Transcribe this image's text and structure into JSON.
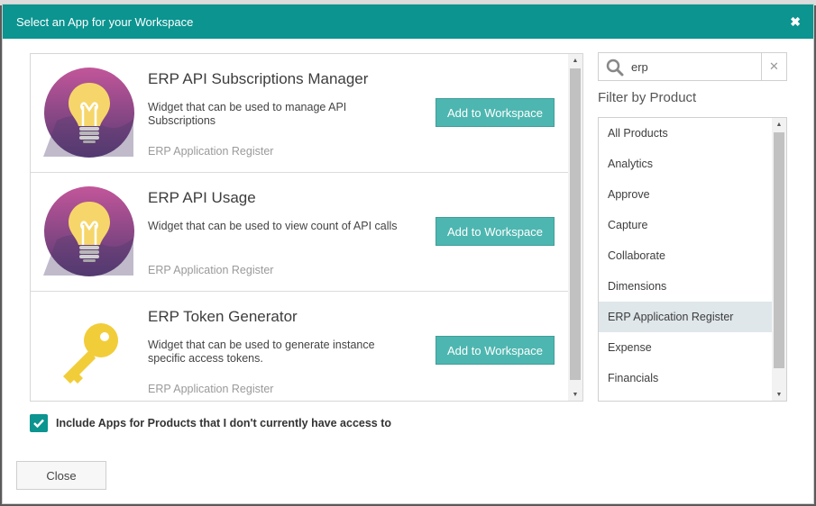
{
  "dialog": {
    "title": "Select an App for your Workspace",
    "close_symbol": "✖"
  },
  "apps": [
    {
      "title": "ERP API Subscriptions Manager",
      "description": "Widget that can be used to manage API Subscriptions",
      "product": "ERP Application Register",
      "button_label": "Add to Workspace",
      "icon": "lightbulb-icon"
    },
    {
      "title": "ERP API Usage",
      "description": "Widget that can be used to view count of API calls",
      "product": "ERP Application Register",
      "button_label": "Add to Workspace",
      "icon": "lightbulb-icon"
    },
    {
      "title": "ERP Token Generator",
      "description": "Widget that can be used to generate instance specific access tokens.",
      "product": "ERP Application Register",
      "button_label": "Add to Workspace",
      "icon": "key-icon"
    }
  ],
  "search": {
    "value": "erp",
    "clear_symbol": "✕"
  },
  "filter": {
    "label": "Filter by Product",
    "selected": "ERP Application Register",
    "items": [
      "All Products",
      "Analytics",
      "Approve",
      "Capture",
      "Collaborate",
      "Dimensions",
      "ERP Application Register",
      "Expense",
      "Financials"
    ]
  },
  "include_apps": {
    "label": "Include Apps for Products that I don't currently have access to",
    "checked": true
  },
  "footer": {
    "close_label": "Close"
  },
  "colors": {
    "header": "#0b9490",
    "button": "#4eb6b0",
    "selected_row": "#dfe7ea"
  }
}
